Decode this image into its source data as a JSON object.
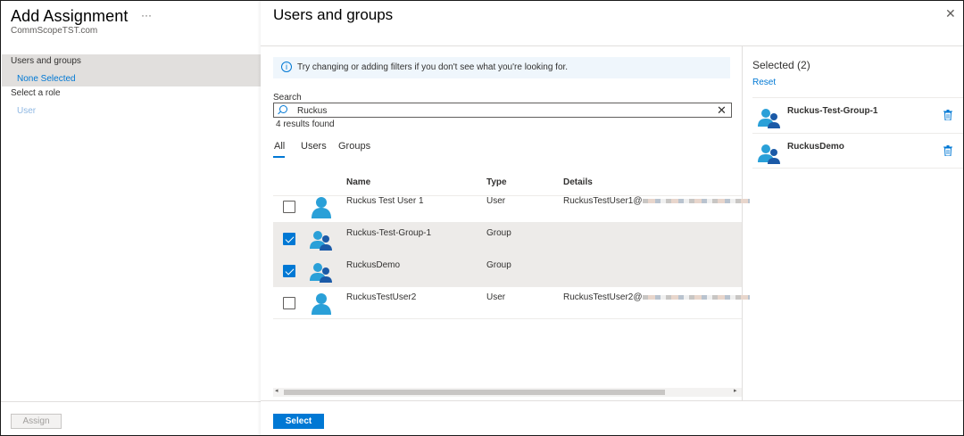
{
  "left_blade": {
    "title": "Add Assignment",
    "more": "···",
    "subtitle": "CommScopeTST.com",
    "users_groups_label": "Users and groups",
    "users_groups_value": "None Selected",
    "role_label": "Select a role",
    "role_value": "User",
    "assign_button": "Assign"
  },
  "right_blade": {
    "title": "Users and groups",
    "close": "✕",
    "info_icon": "i",
    "info_text": "Try changing or adding filters if you don't see what you're looking for.",
    "search": {
      "label": "Search",
      "value": "Ruckus",
      "clear": "✕",
      "results": "4 results found"
    },
    "tabs": [
      "All",
      "Users",
      "Groups"
    ],
    "active_tab": "All",
    "columns": [
      "Name",
      "Type",
      "Details"
    ],
    "rows": [
      {
        "name": "Ruckus Test User 1",
        "type": "User",
        "details": "RuckusTestUser1@",
        "checked": false,
        "kind": "user"
      },
      {
        "name": "Ruckus-Test-Group-1",
        "type": "Group",
        "details": "",
        "checked": true,
        "kind": "group"
      },
      {
        "name": "RuckusDemo",
        "type": "Group",
        "details": "",
        "checked": true,
        "kind": "group"
      },
      {
        "name": "RuckusTestUser2",
        "type": "User",
        "details": "RuckusTestUser2@",
        "checked": false,
        "kind": "user"
      }
    ],
    "scroll_left": "◂",
    "scroll_right": "▸",
    "select_button": "Select"
  },
  "selected_panel": {
    "title": "Selected (2)",
    "reset": "Reset",
    "items": [
      {
        "name": "Ruckus-Test-Group-1",
        "icon": "group-icon"
      },
      {
        "name": "RuckusDemo",
        "icon": "group-icon"
      }
    ]
  },
  "colors": {
    "accent": "#0078d4",
    "avatar": "#2aa0d8",
    "avatar_dark": "#1b5aa7",
    "selected_row": "#edebe9"
  }
}
